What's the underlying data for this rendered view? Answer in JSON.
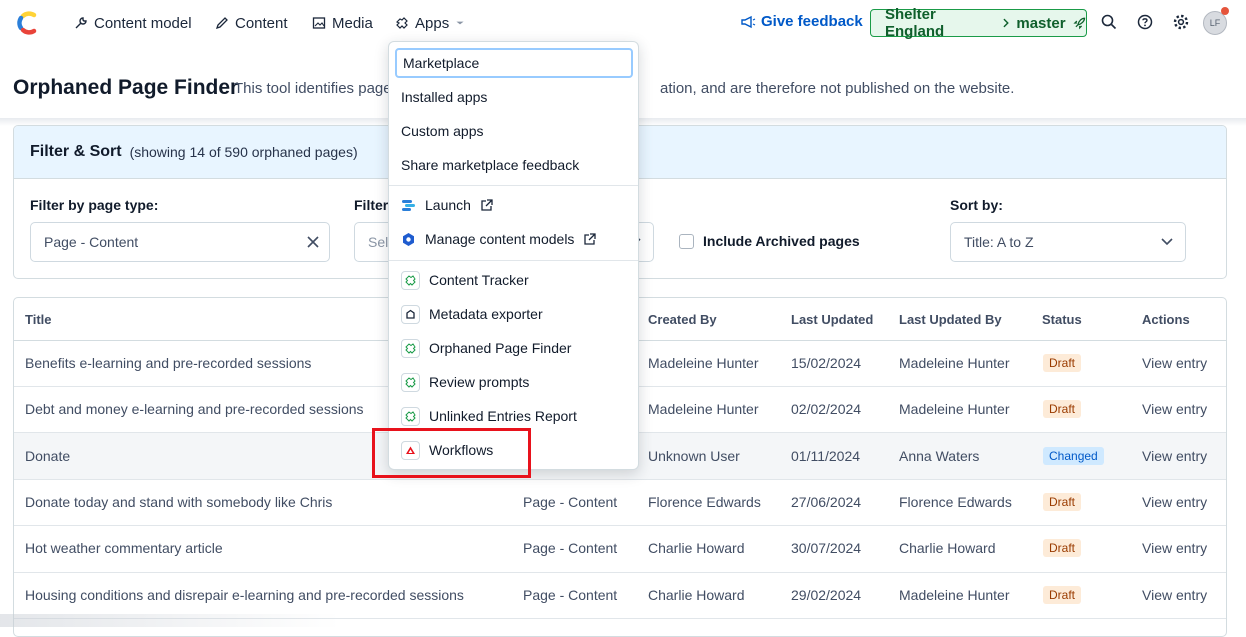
{
  "topbar": {
    "nav": [
      {
        "label": "Content model"
      },
      {
        "label": "Content"
      },
      {
        "label": "Media"
      },
      {
        "label": "Apps"
      }
    ],
    "feedback": "Give feedback",
    "environment": {
      "space": "Shelter England",
      "branch": "master"
    },
    "avatar_initials": "LF"
  },
  "page": {
    "title": "Orphaned Page Finder",
    "description_start": "This tool identifies page",
    "description_end": "ation, and are therefore not published on the website."
  },
  "filter": {
    "heading": "Filter & Sort",
    "count": "(showing 14 of 590 orphaned pages)",
    "page_type_label": "Filter by page type:",
    "page_type_value": "Page - Content",
    "second_label": "Filter",
    "second_placeholder": "Sel",
    "include_archived": "Include Archived pages",
    "sort_label": "Sort by:",
    "sort_value": "Title: A to Z"
  },
  "table": {
    "headers": [
      "Title",
      "Created By",
      "Last Updated",
      "Last Updated By",
      "Status",
      "Actions"
    ],
    "rows": [
      {
        "title": "Benefits e-learning and pre-recorded sessions",
        "type": "",
        "created_by": "Madeleine Hunter",
        "updated": "15/02/2024",
        "updated_by": "Madeleine Hunter",
        "status": "Draft",
        "action": "View entry"
      },
      {
        "title": "Debt and money e-learning and pre-recorded sessions",
        "type": "",
        "created_by": "Madeleine Hunter",
        "updated": "02/02/2024",
        "updated_by": "Madeleine Hunter",
        "status": "Draft",
        "action": "View entry"
      },
      {
        "title": "Donate",
        "type": "",
        "created_by": "Unknown User",
        "updated": "01/11/2024",
        "updated_by": "Anna Waters",
        "status": "Changed",
        "action": "View entry"
      },
      {
        "title": "Donate today and stand with somebody like Chris",
        "type": "Page - Content",
        "created_by": "Florence Edwards",
        "updated": "27/06/2024",
        "updated_by": "Florence Edwards",
        "status": "Draft",
        "action": "View entry"
      },
      {
        "title": "Hot weather commentary article",
        "type": "Page - Content",
        "created_by": "Charlie Howard",
        "updated": "30/07/2024",
        "updated_by": "Charlie Howard",
        "status": "Draft",
        "action": "View entry"
      },
      {
        "title": "Housing conditions and disrepair e-learning and pre-recorded sessions",
        "type": "Page - Content",
        "created_by": "Charlie Howard",
        "updated": "29/02/2024",
        "updated_by": "Madeleine Hunter",
        "status": "Draft",
        "action": "View entry"
      }
    ]
  },
  "apps_menu": {
    "items": [
      "Marketplace",
      "Installed apps",
      "Custom apps",
      "Share marketplace feedback"
    ],
    "launch": "Launch",
    "manage": "Manage content models",
    "apps": [
      "Content Tracker",
      "Metadata exporter",
      "Orphaned Page Finder",
      "Review prompts",
      "Unlinked Entries Report",
      "Workflows"
    ]
  },
  "colors": {
    "accent": "#0059c8",
    "env_green": "#1a9b48",
    "highlight": "#e8121c"
  }
}
